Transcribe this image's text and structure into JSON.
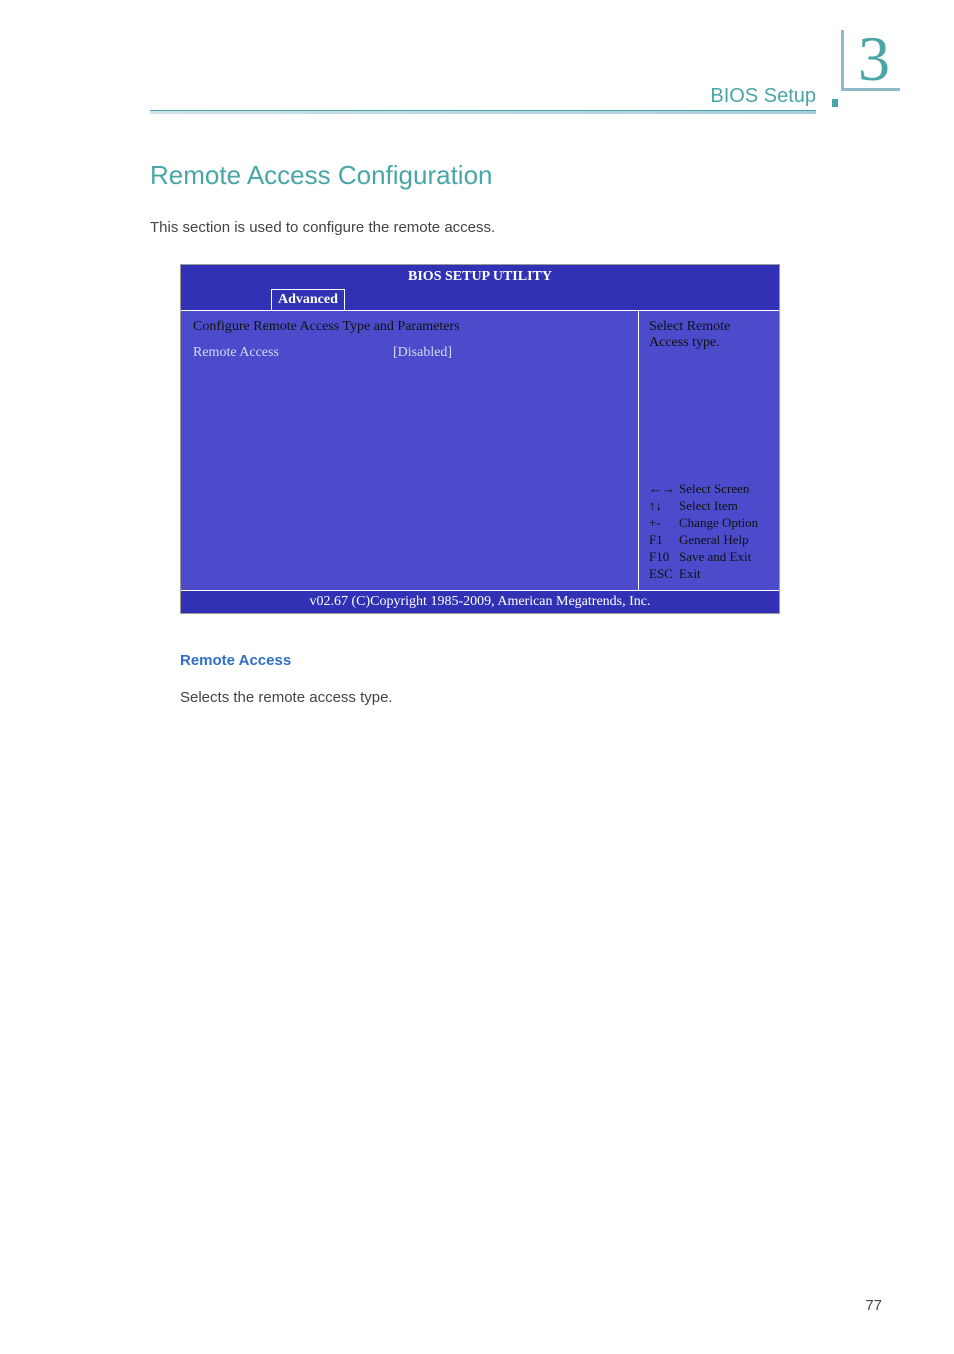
{
  "header": {
    "chapter_number": "3",
    "chapter_label": "BIOS Setup"
  },
  "section": {
    "title": "Remote Access Configuration",
    "intro": "This section is used to configure the remote access."
  },
  "bios": {
    "title": "BIOS SETUP UTILITY",
    "tab": "Advanced",
    "subtitle": "Configure Remote Access Type and Parameters",
    "setting_label": "Remote Access",
    "setting_value": "[Disabled]",
    "help": "Select Remote Access type.",
    "keys": {
      "k1": "←→",
      "d1": "Select Screen",
      "k2": "↑↓",
      "d2": "Select Item",
      "k3": "+-",
      "d3": "Change Option",
      "k4": "F1",
      "d4": "General Help",
      "k5": "F10",
      "d5": "Save and Exit",
      "k6": "ESC",
      "d6": "Exit"
    },
    "footer": "v02.67 (C)Copyright 1985-2009, American Megatrends, Inc."
  },
  "body": {
    "sub_heading": "Remote Access",
    "sub_text": "Selects the remote access type."
  },
  "page_number": "77"
}
